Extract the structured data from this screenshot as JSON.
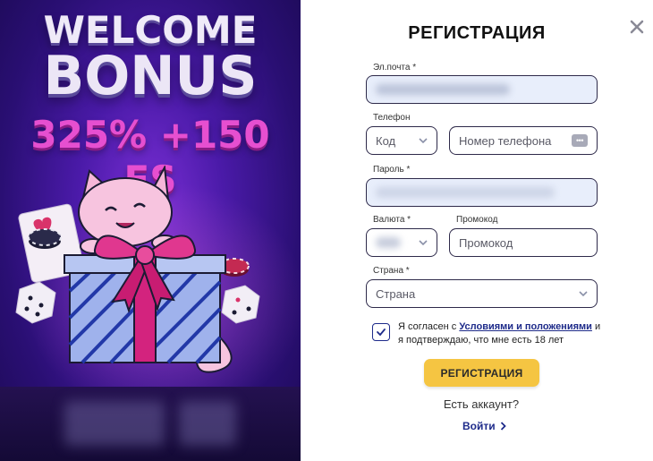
{
  "promo": {
    "welcome": "WELCOME",
    "bonus": "BONUS",
    "offer": "325% +150 FS"
  },
  "modal": {
    "title": "РЕГИСТРАЦИЯ",
    "email": {
      "label": "Эл.почта *"
    },
    "phone": {
      "label": "Телефон",
      "code_placeholder": "Код",
      "number_placeholder": "Номер телефона",
      "dots_icon": "•••"
    },
    "password": {
      "label": "Пароль *"
    },
    "currency": {
      "label": "Валюта *"
    },
    "promocode": {
      "label": "Промокод",
      "placeholder": "Промокод"
    },
    "country": {
      "label": "Страна *",
      "placeholder": "Страна"
    },
    "consent": {
      "prefix": "Я согласен с ",
      "link": "Условиями и положениями",
      "suffix": " и я подтверждаю, что мне есть 18 лет",
      "checked": true
    },
    "submit_label": "РЕГИСТРАЦИЯ",
    "have_account": "Есть аккаунт?",
    "login_label": "Войти"
  },
  "colors": {
    "accent": "#1e2b8a",
    "button": "#f5c542",
    "offer": "#e64fd0"
  }
}
